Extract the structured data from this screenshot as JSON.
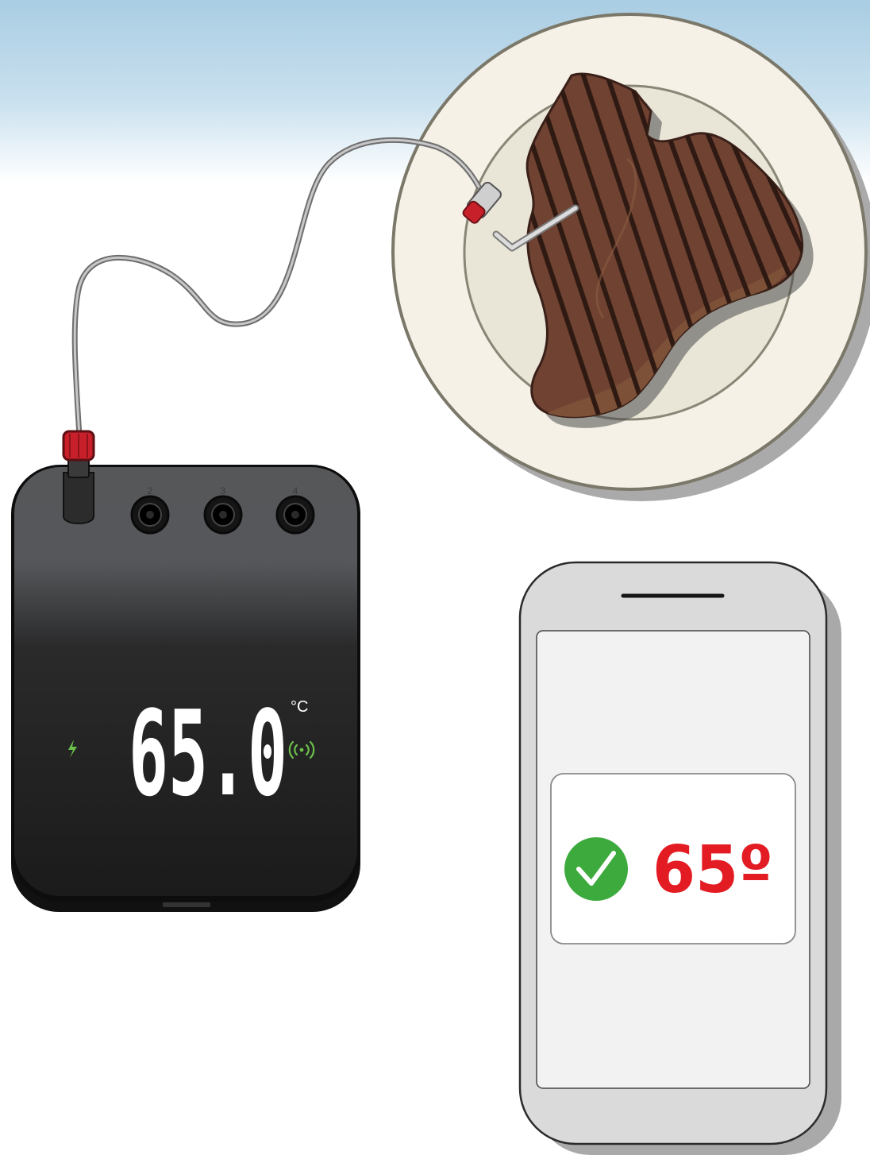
{
  "thermometer": {
    "ports": [
      "2",
      "3",
      "4"
    ],
    "temperature": "65.0",
    "unit": "°C",
    "charging_icon": "lightning-bolt-icon",
    "wireless_icon": "wireless-signal-icon"
  },
  "phone": {
    "temperature": "65º",
    "status_icon": "check-circle-icon",
    "colors": {
      "check": "#3daa3d",
      "temperature": "#e31b23"
    }
  },
  "colors": {
    "steak": "#6f4232",
    "plate": "#f5f1e6",
    "device": "#1e1e1e",
    "probe_cap": "#c8202a"
  }
}
